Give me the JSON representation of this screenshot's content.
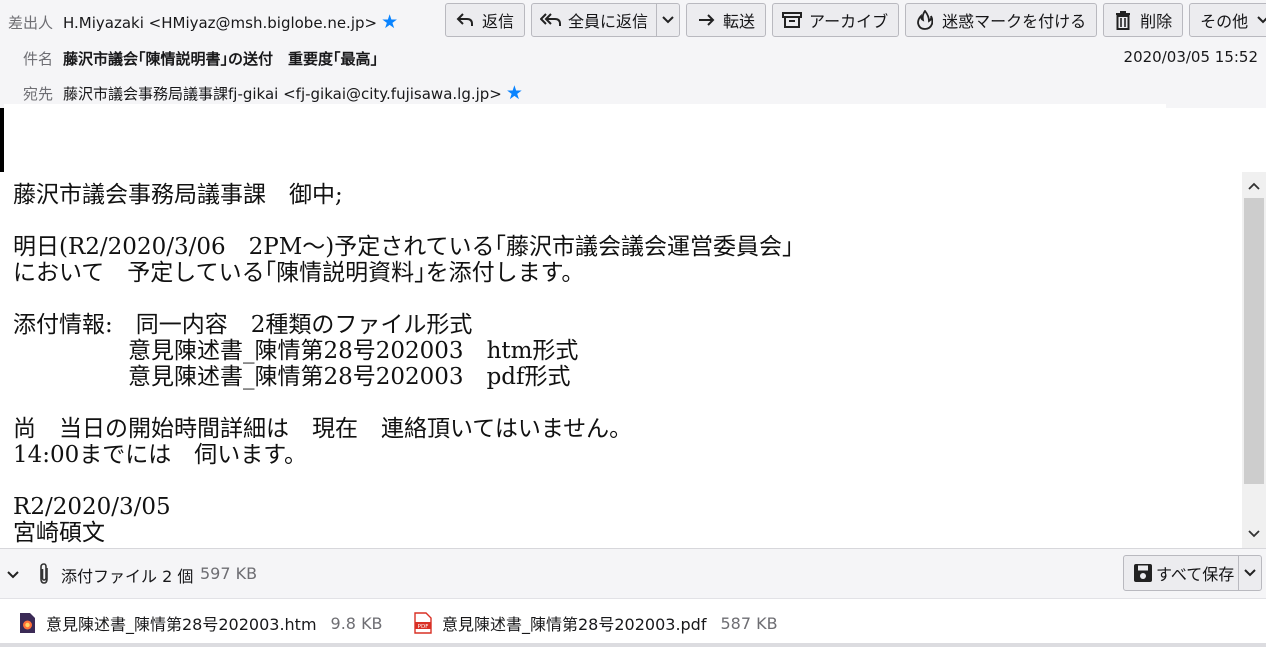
{
  "header": {
    "from_label": "差出人",
    "from_value": "H.Miyazaki <HMiyaz@msh.biglobe.ne.jp>",
    "subject_label": "件名",
    "subject_value": "藤沢市議会｢陳情説明書｣の送付　重要度｢最高｣",
    "date": "2020/03/05 15:52",
    "to_label": "宛先",
    "to_value": "藤沢市議会事務局議事課fj-gikai <fj-gikai@city.fujisawa.lg.jp>"
  },
  "toolbar": {
    "reply": "返信",
    "reply_all": "全員に返信",
    "forward": "転送",
    "archive": "アーカイブ",
    "junk": "迷惑マークを付ける",
    "delete": "削除",
    "other": "その他"
  },
  "body": {
    "lines": [
      "藤沢市議会事務局議事課　御中;",
      "",
      "明日(R2/2020/3/06　2PM～)予定されている｢藤沢市議会議会運営委員会｣",
      "において　予定している｢陳情説明資料｣を添付します。",
      "",
      "添付情報:　同一内容　2種類のファイル形式",
      "　　　　　意見陳述書_陳情第28号202003　htm形式",
      "　　　　　意見陳述書_陳情第28号202003　pdf形式",
      "",
      "尚　当日の開始時間詳細は　現在　連絡頂いてはいません。",
      "14:00までには　伺います。",
      "",
      "R2/2020/3/05",
      "宮崎碩文"
    ]
  },
  "attachments": {
    "summary_label": "添付ファイル 2 個",
    "total_size": "597 KB",
    "save_all": "すべて保存",
    "files": [
      {
        "name": "意見陳述書_陳情第28号202003.htm",
        "size": "9.8 KB",
        "icon": "html-file-icon"
      },
      {
        "name": "意見陳述書_陳情第28号202003.pdf",
        "size": "587 KB",
        "icon": "pdf-file-icon"
      }
    ]
  },
  "colors": {
    "accent_star": "#0a84ff",
    "header_bg": "#f5f5f7",
    "pdf_red": "#d93025"
  }
}
